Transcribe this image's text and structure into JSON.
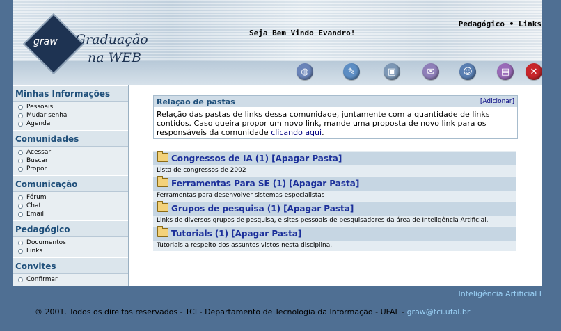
{
  "header": {
    "logo_mark": "graw",
    "logo_line1": "Graduação",
    "logo_line2": "na WEB",
    "welcome": "Seja Bem Vindo Evandro!",
    "top_link_1": "Pedagógico",
    "top_sep": " • ",
    "top_link_2": "Links",
    "icons": [
      {
        "name": "globe",
        "color": "#6a84b9"
      },
      {
        "name": "palette",
        "color": "#5d8ec4"
      },
      {
        "name": "slides",
        "color": "#7d98b6"
      },
      {
        "name": "notes",
        "color": "#8f7fb9"
      },
      {
        "name": "user",
        "color": "#5a7fb2"
      },
      {
        "name": "books",
        "color": "#9a6bb8"
      },
      {
        "name": "close",
        "color": "#c8262b"
      }
    ]
  },
  "sidebar": {
    "sections": [
      {
        "title": "Minhas Informações",
        "items": [
          "Pessoais",
          "Mudar senha",
          "Agenda"
        ]
      },
      {
        "title": "Comunidades",
        "items": [
          "Acessar",
          "Buscar",
          "Propor"
        ]
      },
      {
        "title": "Comunicação",
        "items": [
          "Fórum",
          "Chat",
          "Email"
        ]
      },
      {
        "title": "Pedagógico",
        "items": [
          "Documentos",
          "Links"
        ]
      },
      {
        "title": "Convites",
        "items": [
          "Confirmar"
        ]
      }
    ]
  },
  "main": {
    "box_title": "Relação de pastas",
    "box_action": "[Adicionar]",
    "box_text": "Relação das pastas de links dessa comunidade, juntamente com a quantidade de links contidos. Caso queira propor um novo link, mande uma proposta de novo link para os responsáveis da comunidade ",
    "box_link": "clicando aqui",
    "box_text_end": ".",
    "folders": [
      {
        "title": "Congressos de IA",
        "count": "(1)",
        "action": "[Apagar Pasta]",
        "desc": "Lista de congressos de 2002"
      },
      {
        "title": "Ferramentas Para SE",
        "count": "(1)",
        "action": "[Apagar Pasta]",
        "desc": "Ferramentas para desenvolver sistemas especialistas"
      },
      {
        "title": "Grupos de pesquisa",
        "count": "(1)",
        "action": "[Apagar Pasta]",
        "desc": "Links de diversos grupos de pesquisa, e sites pessoais de pesquisadores da área de Inteligência Artificial."
      },
      {
        "title": "Tutorials",
        "count": "(1)",
        "action": "[Apagar Pasta]",
        "desc": "Tutoriais a respeito dos assuntos vistos nesta disciplina."
      }
    ]
  },
  "footer": {
    "course": "Inteligência Artificial I",
    "copyright": "® 2001. Todos os direitos reservados - TCI - Departamento de Tecnologia da Informação - UFAL - ",
    "email": "graw@tci.ufal.br"
  }
}
